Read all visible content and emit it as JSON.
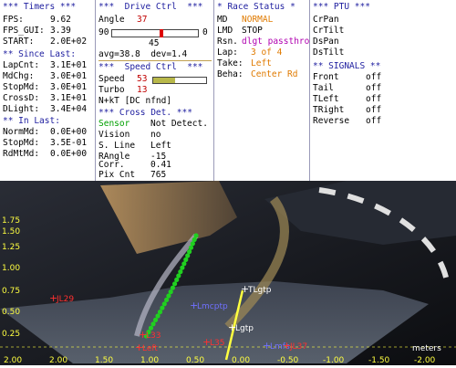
{
  "timers": {
    "title": "*** Timers ***",
    "fps_label": "FPS:",
    "fps": "9.62",
    "fpsgui_label": "FPS_GUI:",
    "fpsgui": "3.39",
    "start_label": "START:",
    "start": "2.0E+02",
    "since_title": "** Since Last:",
    "rows": [
      {
        "label": "LapCnt:",
        "value": "3.1E+01"
      },
      {
        "label": "MdChg:",
        "value": "3.0E+01"
      },
      {
        "label": "StopMd:",
        "value": "3.0E+01"
      },
      {
        "label": "CrossD:",
        "value": "3.1E+01"
      },
      {
        "label": "DLight:",
        "value": "3.4E+04"
      }
    ],
    "inlast_title": "** In Last:",
    "rows2": [
      {
        "label": "NormMd:",
        "value": "0.0E+00"
      },
      {
        "label": "StopMd:",
        "value": "3.5E-01"
      },
      {
        "label": "RdMtMd:",
        "value": "0.0E+00"
      }
    ]
  },
  "drive": {
    "title": "***  Drive Ctrl  ***",
    "angle_label": "Angle",
    "angle": "37",
    "slider_left": "90",
    "slider_right": "0",
    "slider_mid": "45",
    "slider_level": 0.58,
    "avg_dev": "avg=38.8  dev=1.4",
    "speed_title": "***  Speed Ctrl  ***",
    "speed_label": "Speed",
    "speed": "53",
    "speed_level": 0.42,
    "turbo_label": "Turbo",
    "turbo": "13",
    "nkt": "N+kT [DC nfnd]",
    "cross_title": "*** Cross Det. ***",
    "sensor_label": "Sensor",
    "sensor": "Not Detect.",
    "vision_label": "Vision",
    "vision": "no",
    "sline_label": "S. Line",
    "sline": "Left",
    "rangle_label": "RAngle",
    "rangle": "-15",
    "corr_label": "Corr.",
    "corr": "0.41",
    "pix_label": "Pix Cnt",
    "pix": "765"
  },
  "race": {
    "title": "* Race Status *",
    "md_label": "MD",
    "md": "NORMAL",
    "lmd_label": "LMD",
    "lmd": "STOP",
    "rsn_label": "Rsn.",
    "rsn": "dlgt passthro",
    "lap_label": "Lap:",
    "lap": "3 of 4",
    "take_label": "Take:",
    "take": "Left",
    "beha_label": "Beha:",
    "beha": "Center Rd"
  },
  "ptu": {
    "title": "*** PTU ***",
    "items": [
      "CrPan",
      "CrTilt",
      "DsPan",
      "DsTilt"
    ],
    "signals_title": "** SIGNALS **",
    "signals": [
      {
        "label": "Front",
        "value": "off"
      },
      {
        "label": "Tail",
        "value": "off"
      },
      {
        "label": "TLeft",
        "value": "off"
      },
      {
        "label": "TRight",
        "value": "off"
      },
      {
        "label": "Reverse",
        "value": "off"
      }
    ]
  },
  "overlay": {
    "y_labels": [
      "1.75",
      "1.50",
      "1.25",
      "1.00",
      "0.75",
      "0.50",
      "0.25"
    ],
    "x_labels": [
      "2.00",
      "2.00",
      "1.50",
      "1.00",
      "0.50",
      "0.00",
      "-0.50",
      "-1.00",
      "-1.50",
      "-2.00"
    ],
    "units": "meters",
    "marks": [
      {
        "text": "TLgtp",
        "color": "#ffffff"
      },
      {
        "text": "Lmcptp",
        "color": "#7070ff"
      },
      {
        "text": "Lgtp",
        "color": "#ffffff"
      },
      {
        "text": "Lmfs",
        "color": "#7070ff"
      },
      {
        "text": "Left",
        "color": "#ff3030"
      },
      {
        "text": "JL37",
        "color": "#ff3030"
      },
      {
        "text": "L33",
        "color": "#ff3030"
      },
      {
        "text": "JL29",
        "color": "#ff3030"
      },
      {
        "text": "L35",
        "color": "#ff3030"
      }
    ],
    "colors": {
      "slider_fill": "#b8b84a",
      "track_green": "#20d020"
    }
  }
}
